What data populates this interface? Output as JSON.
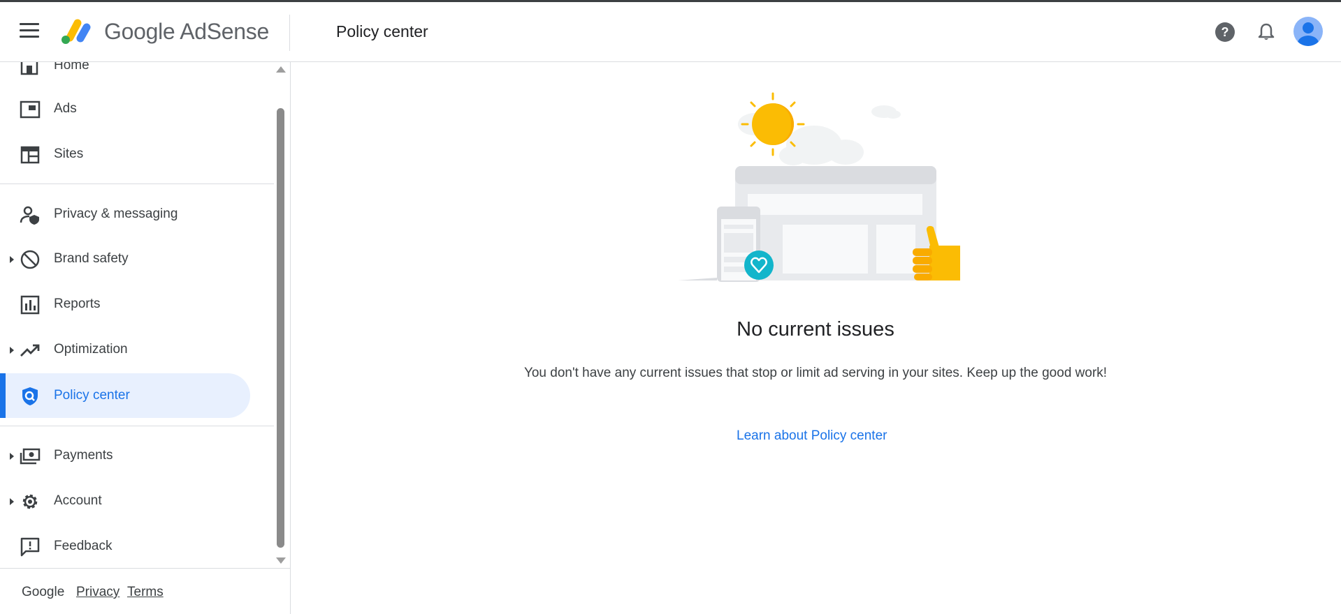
{
  "header": {
    "logo_text": "Google AdSense",
    "title": "Policy center",
    "icons": [
      "menu-icon",
      "help-icon",
      "notifications-icon",
      "account-avatar"
    ]
  },
  "sidebar": {
    "items": [
      {
        "label": "Home",
        "icon": "home-icon",
        "expandable": false
      },
      {
        "label": "Ads",
        "icon": "ads-icon",
        "expandable": false
      },
      {
        "label": "Sites",
        "icon": "sites-icon",
        "expandable": false
      },
      {
        "label": "Privacy & messaging",
        "icon": "privacy-icon",
        "expandable": false
      },
      {
        "label": "Brand safety",
        "icon": "block-icon",
        "expandable": true
      },
      {
        "label": "Reports",
        "icon": "bar-chart-icon",
        "expandable": false
      },
      {
        "label": "Optimization",
        "icon": "trending-up-icon",
        "expandable": true
      },
      {
        "label": "Policy center",
        "icon": "policy-shield-icon",
        "expandable": false,
        "active": true
      },
      {
        "label": "Payments",
        "icon": "payments-icon",
        "expandable": true
      },
      {
        "label": "Account",
        "icon": "gear-icon",
        "expandable": true
      },
      {
        "label": "Feedback",
        "icon": "feedback-icon",
        "expandable": false
      }
    ],
    "footer": {
      "brand": "Google",
      "privacy": "Privacy",
      "terms": "Terms"
    }
  },
  "main": {
    "title": "No current issues",
    "description": "You don't have any current issues that stop or limit ad serving in your sites. Keep up the good work!",
    "link": "Learn about Policy center"
  },
  "colors": {
    "accent": "#1a73e8",
    "active_bg": "#e8f0fe",
    "sun": "#fbbc04",
    "heart": "#12b5cb"
  }
}
